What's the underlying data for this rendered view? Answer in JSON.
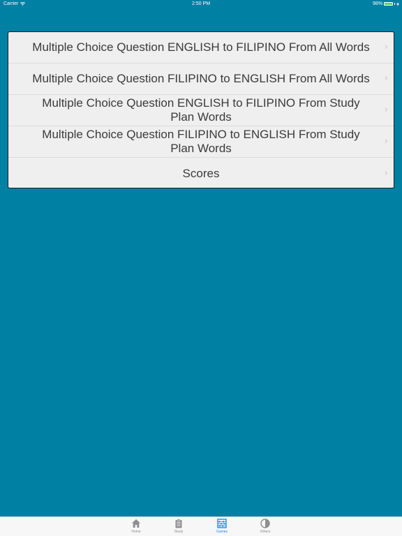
{
  "status": {
    "carrier": "Carrier",
    "time": "2:50 PM",
    "battery": "98%",
    "battery_level": 0.98
  },
  "menu": {
    "items": [
      {
        "label": "Multiple Choice Question ENGLISH to FILIPINO From All Words",
        "icon": "chevron-right-icon"
      },
      {
        "label": "Multiple Choice Question FILIPINO to ENGLISH From All Words",
        "icon": "chevron-right-icon"
      },
      {
        "label": "Multiple Choice Question ENGLISH to FILIPINO From Study Plan Words",
        "icon": "chevron-right-icon"
      },
      {
        "label": "Multiple Choice Question FILIPINO to ENGLISH From Study Plan Words",
        "icon": "chevron-right-icon"
      },
      {
        "label": "Scores",
        "icon": "chevron-right-icon"
      }
    ]
  },
  "tabbar": {
    "tabs": [
      {
        "label": "Home",
        "icon": "home-icon",
        "active": false
      },
      {
        "label": "Study",
        "icon": "clipboard-icon",
        "active": false
      },
      {
        "label": "Games",
        "icon": "abacus-icon",
        "active": true
      },
      {
        "label": "Others",
        "icon": "half-circle-icon",
        "active": false
      }
    ]
  },
  "colors": {
    "background": "#0080a3",
    "menu_background": "#efefef",
    "tab_active": "#1a8cff",
    "tab_inactive": "#8e8e93"
  }
}
